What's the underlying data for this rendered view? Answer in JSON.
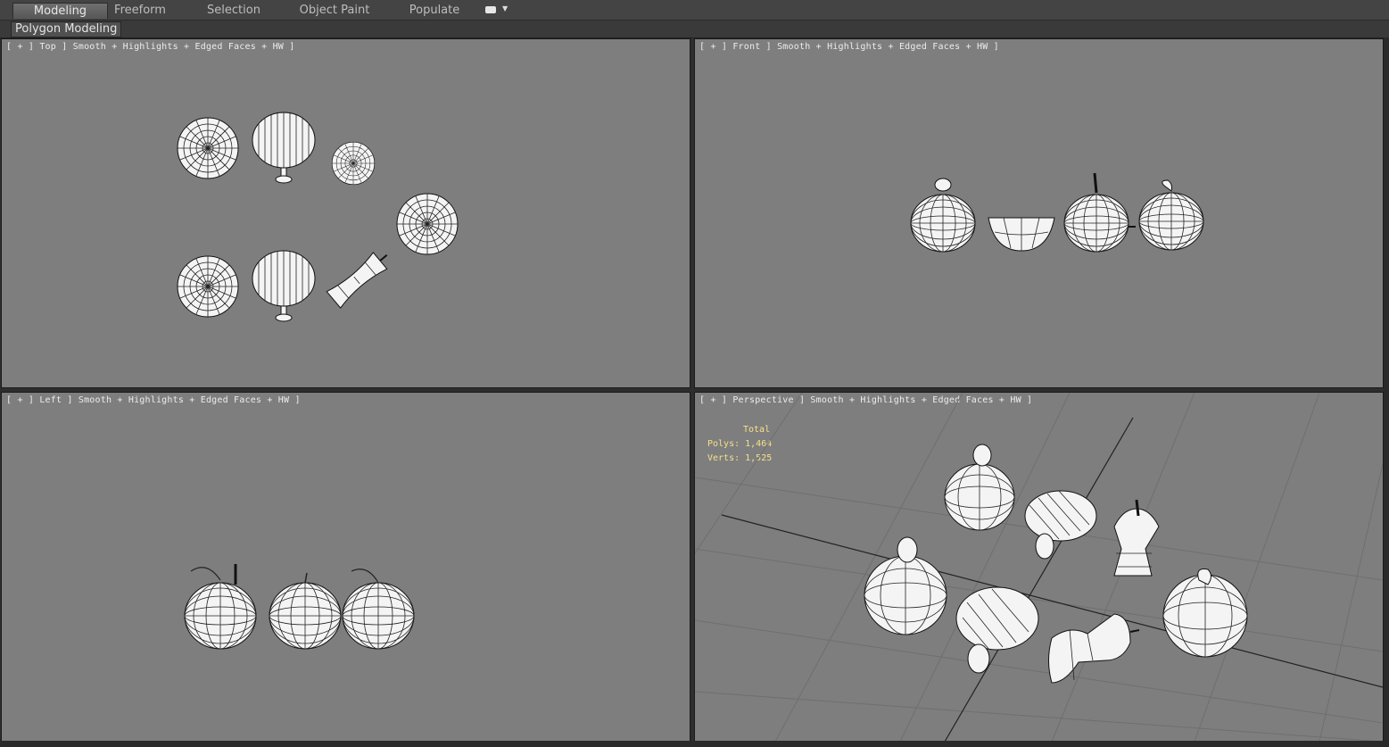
{
  "ribbon": {
    "tabs": [
      {
        "label": "Modeling",
        "active": true
      },
      {
        "label": "Freeform",
        "active": false
      },
      {
        "label": "Selection",
        "active": false
      },
      {
        "label": "Object Paint",
        "active": false
      },
      {
        "label": "Populate",
        "active": false
      }
    ],
    "panel_label": "Polygon Modeling"
  },
  "viewports": {
    "top": {
      "label": "[ + ] Top ] Smooth + Highlights + Edged Faces + HW ]"
    },
    "front": {
      "label": "[ + ] Front ] Smooth + Highlights + Edged Faces + HW ]"
    },
    "left": {
      "label": "[ + ] Left ] Smooth + Highlights + Edged Faces + HW ]"
    },
    "perspective": {
      "label": "[ + ] Perspective ] Smooth + Highlights + Edged Faces + HW ]",
      "stats": {
        "title": "Total",
        "polys": "Polys: 1,464",
        "verts": "Verts: 1,525"
      }
    }
  },
  "colors": {
    "viewport_bg": "#7e7e7e",
    "ui_bg": "#444444",
    "stats_text": "#f5e08a"
  }
}
